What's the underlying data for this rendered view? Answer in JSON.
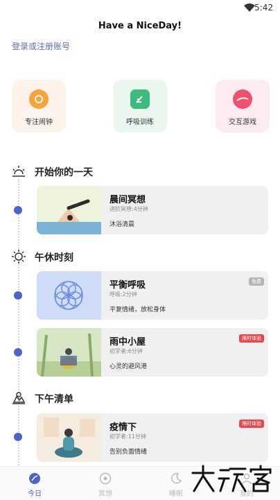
{
  "status_bar": {
    "time": "5:42"
  },
  "header": {
    "title": "Have a NiceDay!",
    "login_link": "登录或注册账号"
  },
  "quick_actions": [
    {
      "label": "专注闹钟",
      "color": "#f3a53a"
    },
    {
      "label": "呼吸训练",
      "color": "#3dba7e"
    },
    {
      "label": "交互游戏",
      "color": "#f0506e"
    }
  ],
  "sections": {
    "morning": {
      "title": "开始你的一天",
      "cards": [
        {
          "title": "晨间冥想",
          "meta": "进阶冥想:4分钟",
          "desc": "沐浴清晨"
        }
      ]
    },
    "noon": {
      "title": "午休时刻",
      "cards": [
        {
          "title": "平衡呼吸",
          "meta": "呼吸:2分钟",
          "desc": "平复情绪，放松身体",
          "badge": "免费"
        },
        {
          "title": "雨中小屋",
          "meta": "初学者:6分钟",
          "desc": "心灵的避风港",
          "badge": "限时体验"
        }
      ]
    },
    "afternoon": {
      "title": "下午清单",
      "cards": [
        {
          "title": "疫情下",
          "meta": "初学者:11分钟",
          "desc": "告别负面情绪",
          "badge": "限时体验"
        }
      ]
    }
  },
  "bottom_nav": [
    {
      "label": "今日",
      "active": true
    },
    {
      "label": "冥想",
      "active": false
    },
    {
      "label": "睡眠",
      "active": false
    },
    {
      "label": "我的",
      "active": false
    }
  ],
  "watermark": {
    "text": "大玩客"
  },
  "colors": {
    "accent": "#4f62c9",
    "badge_red": "#e5484d",
    "badge_gray": "#b5b5b5"
  }
}
